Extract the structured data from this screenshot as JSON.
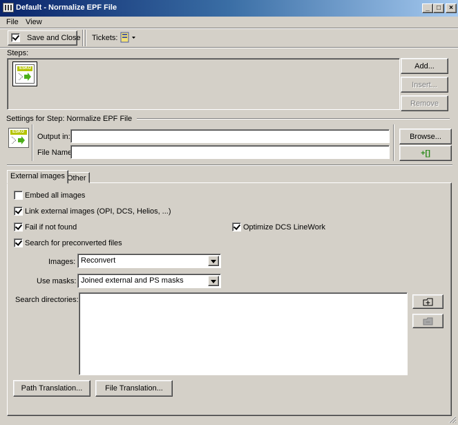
{
  "window": {
    "title": "Default - Normalize EPF File",
    "minimize_glyph": "_",
    "maximize_glyph": "□",
    "close_glyph": "×"
  },
  "menu": {
    "items": [
      "File",
      "View"
    ]
  },
  "toolbar": {
    "save_close_label": "Save and Close",
    "tickets_label": "Tickets:",
    "ticket_icon": "ticket-icon"
  },
  "steps": {
    "label": "Steps:",
    "add_label": "Add...",
    "insert_label": "Insert...",
    "remove_label": "Remove",
    "logo_text": "ESKO"
  },
  "settings": {
    "header": "Settings for Step: Normalize EPF File",
    "output_in_label": "Output in:",
    "output_in_value": "",
    "file_name_label": "File Name:",
    "file_name_value": "",
    "browse_label": "Browse...",
    "smartname_label": "+[]",
    "logo_text": "ESKO"
  },
  "tabs": [
    {
      "label": "External images",
      "active": true
    },
    {
      "label": "Other",
      "active": false
    }
  ],
  "external_images": {
    "embed_all": {
      "label": "Embed all images",
      "checked": false
    },
    "link_external": {
      "label": "Link external images (OPI, DCS, Helios, ...)",
      "checked": true
    },
    "fail_if_not_found": {
      "label": "Fail if not found",
      "checked": true
    },
    "optimize_dcs": {
      "label": "Optimize DCS LineWork",
      "checked": true
    },
    "search_preconverted": {
      "label": "Search for preconverted files",
      "checked": true
    },
    "images_label": "Images:",
    "images_value": "Reconvert",
    "use_masks_label": "Use masks:",
    "use_masks_value": "Joined external and PS masks",
    "search_dirs_label": "Search directories:",
    "path_translation_label": "Path Translation...",
    "file_translation_label": "File Translation..."
  },
  "colors": {
    "face": "#d4d0c8",
    "title_start": "#0a246a",
    "title_end": "#a6caf0",
    "esko_green": "#b5c400",
    "arrow_green": "#4caf1a"
  }
}
